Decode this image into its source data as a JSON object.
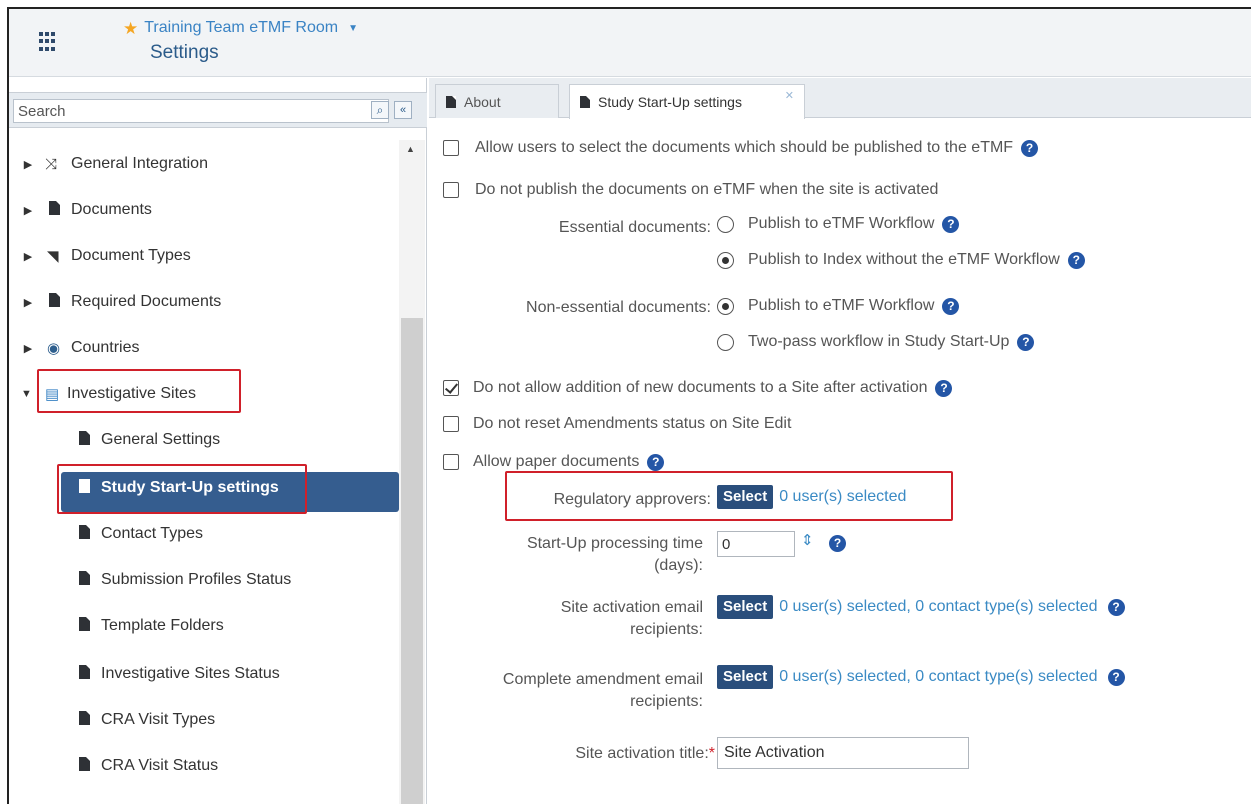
{
  "header": {
    "room_name": "Training Team eTMF Room",
    "page_title": "Settings"
  },
  "sidebar": {
    "search_placeholder": "Search",
    "items": [
      {
        "label": "General Integration",
        "icon": "shuffle-icon"
      },
      {
        "label": "Documents",
        "icon": "document-icon"
      },
      {
        "label": "Document Types",
        "icon": "tag-icon"
      },
      {
        "label": "Required Documents",
        "icon": "clipboard-icon"
      },
      {
        "label": "Countries",
        "icon": "globe-icon"
      },
      {
        "label": "Investigative Sites",
        "icon": "sites-icon",
        "expanded": true
      },
      {
        "label": "General Settings",
        "icon": "document-icon"
      },
      {
        "label": "Study Start-Up settings",
        "icon": "document-icon",
        "selected": true
      },
      {
        "label": "Contact Types",
        "icon": "document-icon"
      },
      {
        "label": "Submission Profiles Status",
        "icon": "document-icon"
      },
      {
        "label": "Template Folders",
        "icon": "document-icon"
      },
      {
        "label": "Investigative Sites Status",
        "icon": "document-icon"
      },
      {
        "label": "CRA Visit Types",
        "icon": "document-icon"
      },
      {
        "label": "CRA Visit Status",
        "icon": "document-icon"
      }
    ]
  },
  "tabs": [
    {
      "label": "About"
    },
    {
      "label": "Study Start-Up settings",
      "active": true
    }
  ],
  "settings": {
    "opt_select_docs": {
      "label": "Allow users to select the documents which should be published to the eTMF",
      "checked": false
    },
    "opt_no_publish": {
      "label": "Do not publish the documents on eTMF when the site is activated",
      "checked": false
    },
    "essential_label": "Essential documents:",
    "essential_opt1": {
      "label": "Publish to eTMF Workflow",
      "checked": false
    },
    "essential_opt2": {
      "label": "Publish to Index without the eTMF Workflow",
      "checked": true
    },
    "nonessential_label": "Non-essential documents:",
    "nonessential_opt1": {
      "label": "Publish to eTMF Workflow",
      "checked": true
    },
    "nonessential_opt2": {
      "label": "Two-pass workflow in Study Start-Up",
      "checked": false
    },
    "opt_no_addition": {
      "label": "Do not allow addition of new documents to a Site after activation",
      "checked": true
    },
    "opt_no_reset": {
      "label": "Do not reset Amendments status on Site Edit",
      "checked": false
    },
    "opt_paper": {
      "label": "Allow paper documents",
      "checked": false
    },
    "regulatory_label": "Regulatory approvers:",
    "regulatory_value": "0 user(s) selected",
    "processing_label_1": "Start-Up processing time",
    "processing_label_2": "(days):",
    "processing_value": "0",
    "activation_email_label_1": "Site activation email",
    "activation_email_label_2": "recipients:",
    "activation_email_value": "0 user(s) selected, 0 contact type(s) selected",
    "amendment_email_label_1": "Complete amendment email",
    "amendment_email_label_2": "recipients:",
    "amendment_email_value": "0 user(s) selected, 0 contact type(s) selected",
    "activation_title_label": "Site activation title:",
    "required_mark": "*",
    "activation_title_value": "Site Activation",
    "select_label": "Select",
    "help_glyph": "?"
  },
  "colors": {
    "accent": "#355d8f",
    "link": "#3a8ac4",
    "highlight": "#d0202a",
    "help": "#2456a6"
  }
}
